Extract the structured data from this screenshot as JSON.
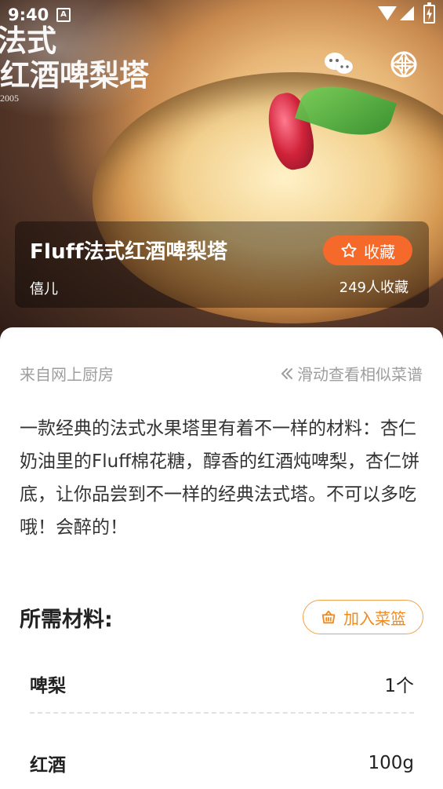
{
  "status_bar": {
    "time": "9:40",
    "notif_letter": "A"
  },
  "hero": {
    "watermark_line1": "法式",
    "watermark_line2": "红酒啤梨塔",
    "watermark_small": "2005",
    "share_wechat_icon": "wechat-icon",
    "share_moments_icon": "shutter-icon",
    "title": "Fluff法式红酒啤梨塔",
    "author": "僖儿",
    "favorite_label": "收藏",
    "favorite_count": "249人收藏",
    "favorite_icon": "star-outline-icon",
    "accent_color": "#f56a2a"
  },
  "content": {
    "source": "来自网上厨房",
    "swipe_hint": "滑动查看相似菜谱",
    "description": "一款经典的法式水果塔里有着不一样的材料：杏仁奶油里的Fluff棉花糖，醇香的红酒炖啤梨，杏仁饼底，让你品尝到不一样的经典法式塔。不可以多吃哦！会醉的！",
    "ingredients_title": "所需材料:",
    "add_to_basket_label": "加入菜篮",
    "ingredients": [
      {
        "name": "啤梨",
        "amount": "1个"
      },
      {
        "name": "红酒",
        "amount": "100g"
      }
    ]
  }
}
